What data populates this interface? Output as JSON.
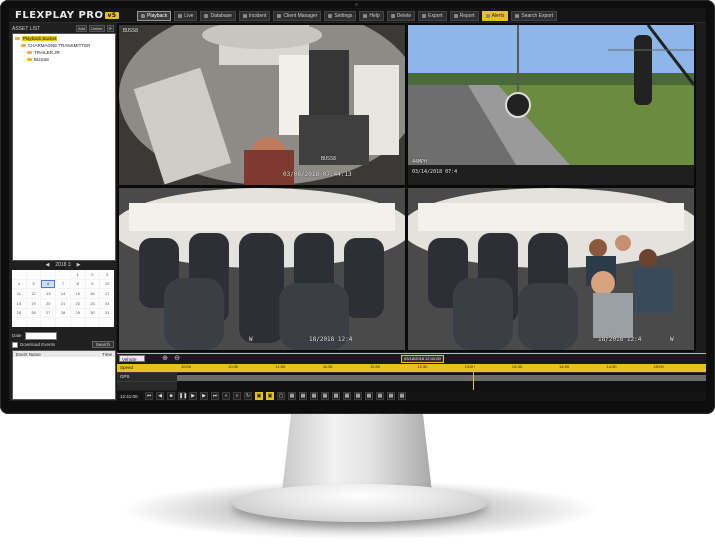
{
  "app": {
    "logo": "FLEXPLAY PRO",
    "version_badge": "v5",
    "brand_accent": "#e5c21d"
  },
  "toolbar": [
    {
      "label": "Playback",
      "active": true,
      "icon": "play-icon"
    },
    {
      "label": "Live",
      "icon": "camera-icon"
    },
    {
      "label": "Database",
      "icon": "database-icon"
    },
    {
      "label": "Incident",
      "icon": "document-icon"
    },
    {
      "label": "Client Manager",
      "icon": "users-icon"
    },
    {
      "label": "Settings",
      "icon": "gear-icon"
    },
    {
      "label": "Help",
      "icon": "help-icon"
    },
    {
      "label": "Delete",
      "icon": "trash-icon"
    },
    {
      "label": "Export",
      "icon": "export-icon"
    },
    {
      "label": "Report",
      "icon": "report-icon"
    },
    {
      "label": "Alerts",
      "highlight": true,
      "icon": "bell-icon"
    },
    {
      "label": "Search Export",
      "icon": "search-icon"
    }
  ],
  "left_panel": {
    "title": "ASSET LIST",
    "add_label": "Add",
    "delete_label": "Delete",
    "tree": [
      {
        "label": "Playback Bucket",
        "selected": true
      },
      {
        "label": "CHARMAGNE TRANSMITTER"
      },
      {
        "label": "TRAILER.JR"
      },
      {
        "label": "BUSS8"
      }
    ],
    "calendar": {
      "month_label": "2018 3",
      "days": [
        "",
        "",
        "",
        "",
        "1",
        "2",
        "3",
        "4",
        "5",
        "6",
        "7",
        "8",
        "9",
        "10",
        "11",
        "12",
        "13",
        "14",
        "15",
        "16",
        "17",
        "18",
        "19",
        "20",
        "21",
        "22",
        "23",
        "24",
        "25",
        "26",
        "27",
        "28",
        "29",
        "30",
        "31",
        "",
        "",
        "",
        "",
        "",
        "",
        ""
      ],
      "today": "6"
    },
    "filter_label": "Date",
    "download_label": "Download Events",
    "search_label": "Search",
    "events_columns": [
      "Event Name",
      "Time"
    ]
  },
  "videos": [
    {
      "top_label": "BUSS8",
      "bottom_left": "",
      "bottom_right": "03/06/2018 07:44:13",
      "bottom_label": "BUSS8"
    },
    {
      "top_label": "",
      "bottom_left": "44MPH",
      "bottom_right": "",
      "bottom_label": "03/14/2018 07:4"
    },
    {
      "top_label": "",
      "bottom_left": "",
      "bottom_right": "18/2018 12:4",
      "bottom_label": "W"
    },
    {
      "top_label": "",
      "bottom_left": "",
      "bottom_right": "18/2018 12:4",
      "bottom_label": "W"
    }
  ],
  "timeline": {
    "select_label": "Vehicle Status",
    "ruler_ticks": [
      "10:00",
      "10:30",
      "11:00",
      "11:30",
      "12:00",
      "12:30",
      "13:00",
      "13:30",
      "14:00",
      "14:30",
      "15:00"
    ],
    "cursor_label": "03/18/2018 12:41:00",
    "rows": [
      "Speed",
      "GPS"
    ],
    "current_time": "12:41:00",
    "position_fraction": 0.56
  }
}
